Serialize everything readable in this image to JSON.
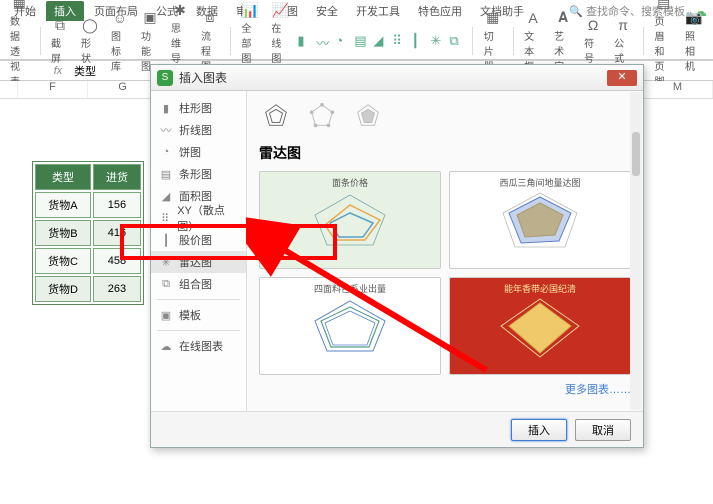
{
  "tabs": [
    "开始",
    "插入",
    "页面布局",
    "公式",
    "数据",
    "审阅",
    "视图",
    "安全",
    "开发工具",
    "特色应用",
    "文档助手"
  ],
  "active_tab": 1,
  "search_placeholder": "查找命令、搜索模板",
  "toolbar": {
    "pivot": "数据透视表",
    "screenshot": "截屏",
    "shapes": "形状",
    "icons": "图标库",
    "features": "功能图",
    "mindmap": "思维导图",
    "flowchart": "流程图",
    "allcharts": "全部图表",
    "onlinechart": "在线图表",
    "slicer": "切片器",
    "textbox": "文本框",
    "wordart": "艺术字",
    "symbol": "符号",
    "formula": "公式",
    "headerfooter": "页眉和页脚",
    "camera": "照相机"
  },
  "formula_bar": {
    "fx": "fx",
    "value": "类型"
  },
  "columns": [
    "F",
    "G",
    "M"
  ],
  "table": {
    "headers": [
      "类型",
      "进货"
    ],
    "rows": [
      [
        "货物A",
        "156"
      ],
      [
        "货物B",
        "416"
      ],
      [
        "货物C",
        "458"
      ],
      [
        "货物D",
        "263"
      ]
    ]
  },
  "dialog": {
    "title": "插入图表",
    "categories": [
      "柱形图",
      "折线图",
      "饼图",
      "条形图",
      "面积图",
      "XY（散点图）",
      "股价图",
      "雷达图",
      "组合图",
      "模板",
      "在线图表"
    ],
    "selected_category": 7,
    "preview_title": "雷达图",
    "thumbs": [
      {
        "caption": "面条价格"
      },
      {
        "caption": "西瓜三角间地量达图"
      },
      {
        "caption": "四面料色系业出量"
      },
      {
        "caption": "能年香带必国纪清"
      }
    ],
    "more": "更多图表……",
    "insert": "插入",
    "cancel": "取消"
  }
}
